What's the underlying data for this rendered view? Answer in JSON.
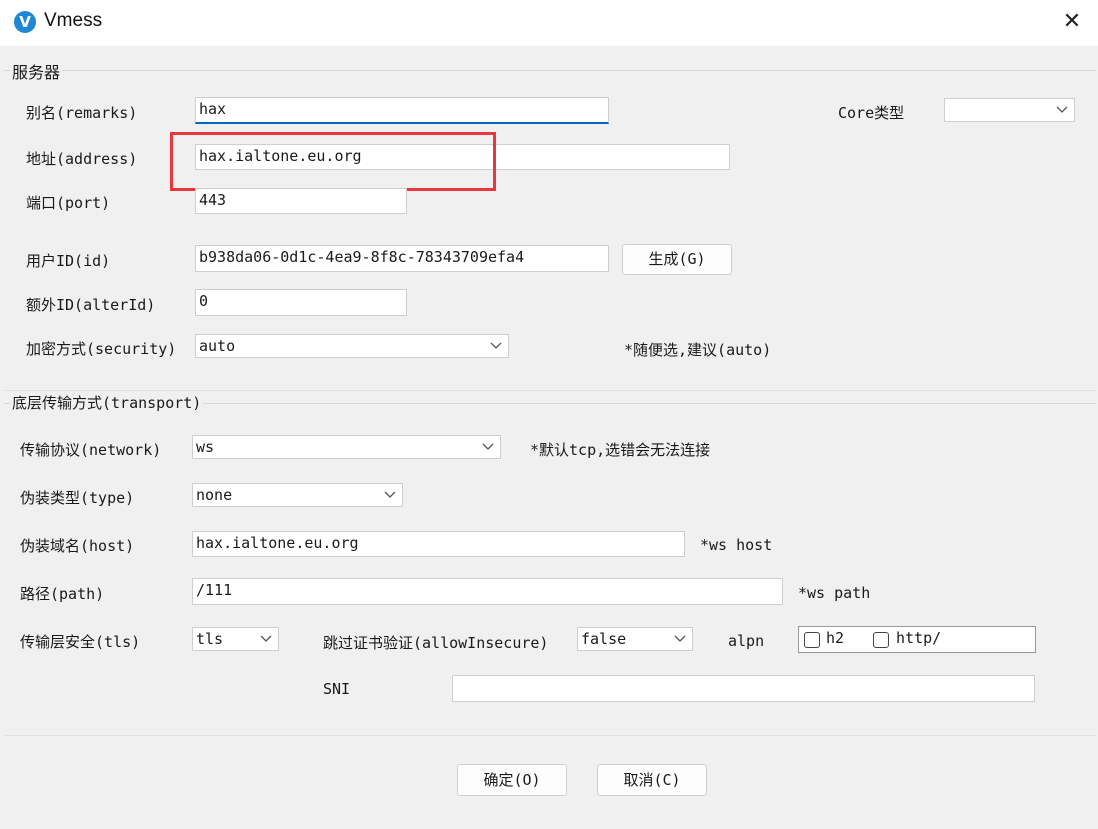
{
  "window": {
    "title": "Vmess",
    "icon": "v-logo-icon",
    "close_glyph": "✕"
  },
  "server": {
    "group_title": "服务器",
    "remarks": {
      "label": "别名(remarks)",
      "value": "hax"
    },
    "core": {
      "label": "Core类型",
      "value": ""
    },
    "address": {
      "label": "地址(address)",
      "value": "hax.ialtone.eu.org"
    },
    "port": {
      "label": "端口(port)",
      "value": "443"
    },
    "id": {
      "label": "用户ID(id)",
      "value": "b938da06-0d1c-4ea9-8f8c-78343709efa4",
      "generate_label": "生成(G)"
    },
    "alterId": {
      "label": "额外ID(alterId)",
      "value": "0"
    },
    "security": {
      "label": "加密方式(security)",
      "value": "auto",
      "hint": "*随便选,建议(auto)"
    }
  },
  "transport": {
    "group_title": "底层传输方式(transport)",
    "network": {
      "label": "传输协议(network)",
      "value": "ws",
      "hint": "*默认tcp,选错会无法连接"
    },
    "type": {
      "label": "伪装类型(type)",
      "value": "none"
    },
    "host": {
      "label": "伪装域名(host)",
      "value": "hax.ialtone.eu.org",
      "hint": "*ws host"
    },
    "path": {
      "label": "路径(path)",
      "value": "/111",
      "hint": "*ws path"
    },
    "tls": {
      "label": "传输层安全(tls)",
      "value": "tls"
    },
    "allowInsecure": {
      "label": "跳过证书验证(allowInsecure)",
      "value": "false"
    },
    "alpn": {
      "label": "alpn",
      "options": [
        {
          "label": "h2",
          "checked": false
        },
        {
          "label": "http/",
          "checked": false
        }
      ]
    },
    "sni": {
      "label": "SNI",
      "value": ""
    }
  },
  "footer": {
    "ok_label": "确定(O)",
    "cancel_label": "取消(C)"
  },
  "colors": {
    "accent": "#0067c0",
    "highlight": "#e8373a",
    "app_icon": "#1e88d6"
  }
}
